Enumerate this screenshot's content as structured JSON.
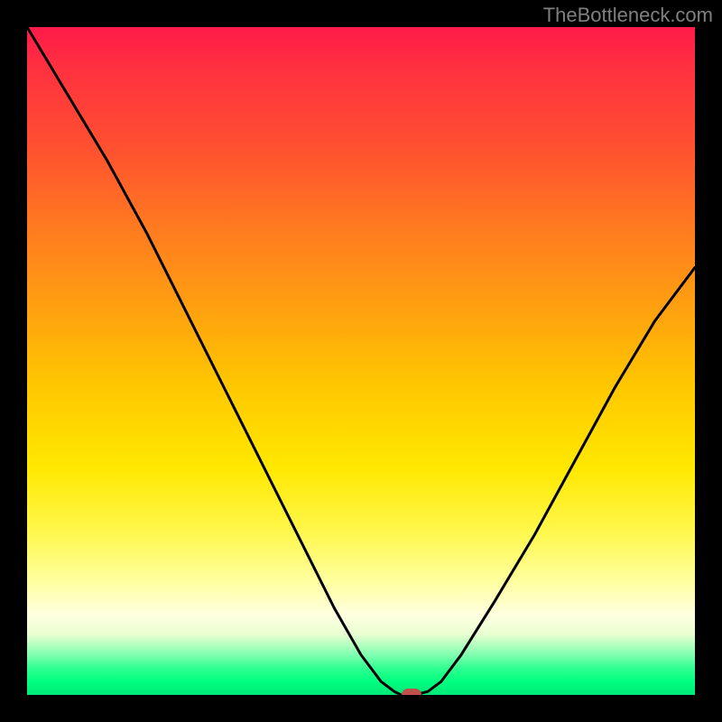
{
  "watermark": "TheBottleneck.com",
  "colors": {
    "frame": "#000000",
    "curve": "#000000",
    "marker": "#c0504d"
  },
  "chart_data": {
    "type": "line",
    "title": "",
    "xlabel": "",
    "ylabel": "",
    "xlim": [
      0,
      100
    ],
    "ylim": [
      0,
      100
    ],
    "x": [
      0,
      6,
      12,
      18,
      22,
      26,
      30,
      34,
      38,
      42,
      46,
      50,
      53,
      55,
      56,
      58,
      60,
      62,
      65,
      70,
      76,
      82,
      88,
      94,
      100
    ],
    "y": [
      100,
      90,
      80,
      69,
      61,
      53,
      45,
      37,
      29,
      21,
      13,
      6,
      2,
      0.5,
      0,
      0,
      0.5,
      2,
      6,
      14,
      24,
      35,
      46,
      56,
      64
    ],
    "marker": {
      "x": 57.5,
      "y": 0
    },
    "flat_bottom": {
      "x_start": 55,
      "x_end": 60,
      "y": 0
    }
  }
}
